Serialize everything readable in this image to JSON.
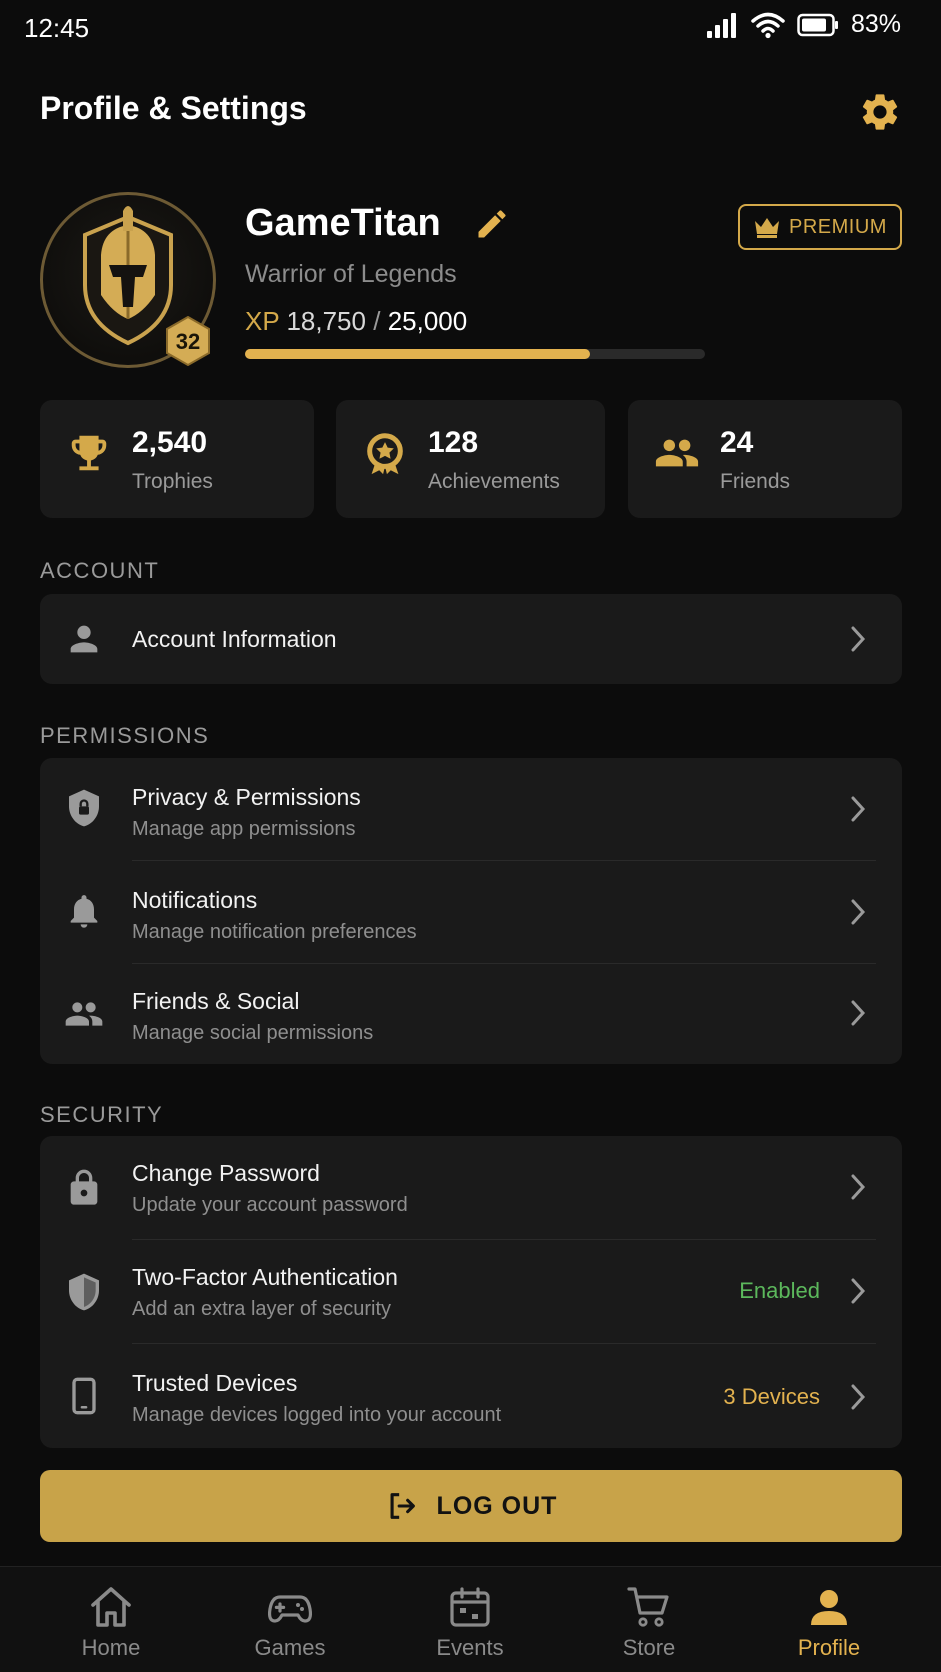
{
  "status_bar": {
    "time": "12:45",
    "battery": "83%"
  },
  "header": {
    "title": "Profile & Settings"
  },
  "profile": {
    "username": "GameTitan",
    "subtitle": "Warrior of Legends",
    "level": "32",
    "premium_label": "PREMIUM",
    "xp_label": "XP",
    "xp_current": "18,750",
    "xp_separator": "/",
    "xp_max": "25,000",
    "xp_progress": 0.75
  },
  "stats": [
    {
      "value": "2,540",
      "label": "Trophies",
      "icon": "trophy-icon"
    },
    {
      "value": "128",
      "label": "Achievements",
      "icon": "medal-icon"
    },
    {
      "value": "24",
      "label": "Friends",
      "icon": "friends-icon"
    }
  ],
  "sections": {
    "account": {
      "title": "ACCOUNT",
      "items": [
        {
          "title": "Account Information"
        }
      ]
    },
    "permissions": {
      "title": "PERMISSIONS",
      "items": [
        {
          "title": "Privacy & Permissions",
          "subtitle": "Manage app permissions"
        },
        {
          "title": "Notifications",
          "subtitle": "Manage notification preferences"
        },
        {
          "title": "Friends & Social",
          "subtitle": "Manage social permissions"
        }
      ]
    },
    "security": {
      "title": "SECURITY",
      "items": [
        {
          "title": "Change Password",
          "subtitle": "Update your account password"
        },
        {
          "title": "Two-Factor Authentication",
          "subtitle": "Add an extra layer of security",
          "status": "Enabled"
        },
        {
          "title": "Trusted Devices",
          "subtitle": "Manage devices logged into your account",
          "status": "3 Devices"
        }
      ]
    }
  },
  "logout": {
    "label": "LOG OUT"
  },
  "nav": [
    {
      "label": "Home"
    },
    {
      "label": "Games"
    },
    {
      "label": "Events"
    },
    {
      "label": "Store"
    },
    {
      "label": "Profile"
    }
  ],
  "colors": {
    "accent": "#e3b24f",
    "background": "#0c0c0c",
    "card": "#1a1a1a",
    "enabled_status": "#5cb85c",
    "devices_status": "#e3b24f"
  }
}
